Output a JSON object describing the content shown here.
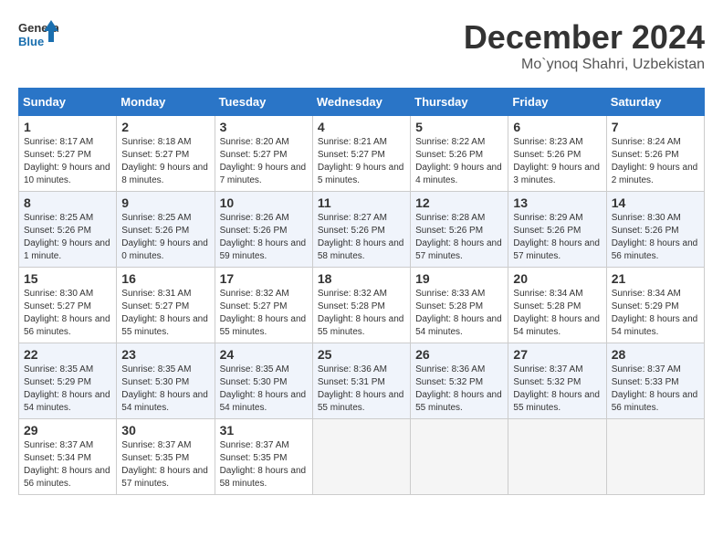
{
  "logo": {
    "line1": "General",
    "line2": "Blue"
  },
  "title": "December 2024",
  "subtitle": "Mo`ynoq Shahri, Uzbekistan",
  "weekdays": [
    "Sunday",
    "Monday",
    "Tuesday",
    "Wednesday",
    "Thursday",
    "Friday",
    "Saturday"
  ],
  "weeks": [
    [
      {
        "day": 1,
        "sunrise": "8:17 AM",
        "sunset": "5:27 PM",
        "daylight": "9 hours and 10 minutes"
      },
      {
        "day": 2,
        "sunrise": "8:18 AM",
        "sunset": "5:27 PM",
        "daylight": "9 hours and 8 minutes"
      },
      {
        "day": 3,
        "sunrise": "8:20 AM",
        "sunset": "5:27 PM",
        "daylight": "9 hours and 7 minutes"
      },
      {
        "day": 4,
        "sunrise": "8:21 AM",
        "sunset": "5:27 PM",
        "daylight": "9 hours and 5 minutes"
      },
      {
        "day": 5,
        "sunrise": "8:22 AM",
        "sunset": "5:26 PM",
        "daylight": "9 hours and 4 minutes"
      },
      {
        "day": 6,
        "sunrise": "8:23 AM",
        "sunset": "5:26 PM",
        "daylight": "9 hours and 3 minutes"
      },
      {
        "day": 7,
        "sunrise": "8:24 AM",
        "sunset": "5:26 PM",
        "daylight": "9 hours and 2 minutes"
      }
    ],
    [
      {
        "day": 8,
        "sunrise": "8:25 AM",
        "sunset": "5:26 PM",
        "daylight": "9 hours and 1 minute"
      },
      {
        "day": 9,
        "sunrise": "8:25 AM",
        "sunset": "5:26 PM",
        "daylight": "9 hours and 0 minutes"
      },
      {
        "day": 10,
        "sunrise": "8:26 AM",
        "sunset": "5:26 PM",
        "daylight": "8 hours and 59 minutes"
      },
      {
        "day": 11,
        "sunrise": "8:27 AM",
        "sunset": "5:26 PM",
        "daylight": "8 hours and 58 minutes"
      },
      {
        "day": 12,
        "sunrise": "8:28 AM",
        "sunset": "5:26 PM",
        "daylight": "8 hours and 57 minutes"
      },
      {
        "day": 13,
        "sunrise": "8:29 AM",
        "sunset": "5:26 PM",
        "daylight": "8 hours and 57 minutes"
      },
      {
        "day": 14,
        "sunrise": "8:30 AM",
        "sunset": "5:26 PM",
        "daylight": "8 hours and 56 minutes"
      }
    ],
    [
      {
        "day": 15,
        "sunrise": "8:30 AM",
        "sunset": "5:27 PM",
        "daylight": "8 hours and 56 minutes"
      },
      {
        "day": 16,
        "sunrise": "8:31 AM",
        "sunset": "5:27 PM",
        "daylight": "8 hours and 55 minutes"
      },
      {
        "day": 17,
        "sunrise": "8:32 AM",
        "sunset": "5:27 PM",
        "daylight": "8 hours and 55 minutes"
      },
      {
        "day": 18,
        "sunrise": "8:32 AM",
        "sunset": "5:28 PM",
        "daylight": "8 hours and 55 minutes"
      },
      {
        "day": 19,
        "sunrise": "8:33 AM",
        "sunset": "5:28 PM",
        "daylight": "8 hours and 54 minutes"
      },
      {
        "day": 20,
        "sunrise": "8:34 AM",
        "sunset": "5:28 PM",
        "daylight": "8 hours and 54 minutes"
      },
      {
        "day": 21,
        "sunrise": "8:34 AM",
        "sunset": "5:29 PM",
        "daylight": "8 hours and 54 minutes"
      }
    ],
    [
      {
        "day": 22,
        "sunrise": "8:35 AM",
        "sunset": "5:29 PM",
        "daylight": "8 hours and 54 minutes"
      },
      {
        "day": 23,
        "sunrise": "8:35 AM",
        "sunset": "5:30 PM",
        "daylight": "8 hours and 54 minutes"
      },
      {
        "day": 24,
        "sunrise": "8:35 AM",
        "sunset": "5:30 PM",
        "daylight": "8 hours and 54 minutes"
      },
      {
        "day": 25,
        "sunrise": "8:36 AM",
        "sunset": "5:31 PM",
        "daylight": "8 hours and 55 minutes"
      },
      {
        "day": 26,
        "sunrise": "8:36 AM",
        "sunset": "5:32 PM",
        "daylight": "8 hours and 55 minutes"
      },
      {
        "day": 27,
        "sunrise": "8:37 AM",
        "sunset": "5:32 PM",
        "daylight": "8 hours and 55 minutes"
      },
      {
        "day": 28,
        "sunrise": "8:37 AM",
        "sunset": "5:33 PM",
        "daylight": "8 hours and 56 minutes"
      }
    ],
    [
      {
        "day": 29,
        "sunrise": "8:37 AM",
        "sunset": "5:34 PM",
        "daylight": "8 hours and 56 minutes"
      },
      {
        "day": 30,
        "sunrise": "8:37 AM",
        "sunset": "5:35 PM",
        "daylight": "8 hours and 57 minutes"
      },
      {
        "day": 31,
        "sunrise": "8:37 AM",
        "sunset": "5:35 PM",
        "daylight": "8 hours and 58 minutes"
      },
      null,
      null,
      null,
      null
    ]
  ]
}
